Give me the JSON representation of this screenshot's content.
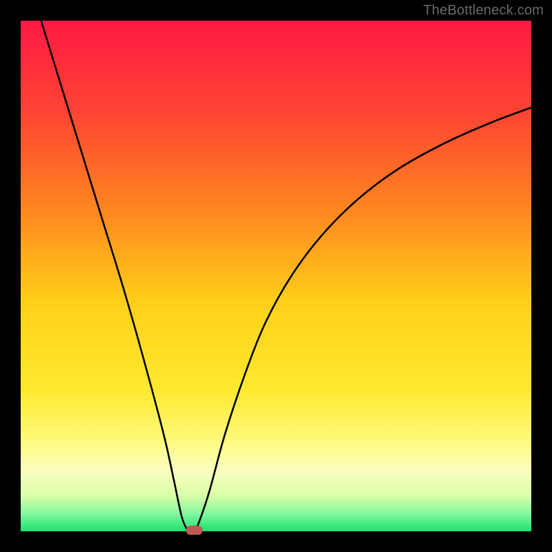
{
  "watermark": "TheBottleneck.com",
  "colors": {
    "frame": "#000000",
    "marker": "#bb5a53",
    "curve": "#000000",
    "watermark_text": "#6a6a6a"
  },
  "gradient_stops": [
    {
      "offset": 0.0,
      "color": "#ff1a44"
    },
    {
      "offset": 0.18,
      "color": "#ff4433"
    },
    {
      "offset": 0.38,
      "color": "#ff8a1f"
    },
    {
      "offset": 0.55,
      "color": "#ffcf1a"
    },
    {
      "offset": 0.72,
      "color": "#ffe92e"
    },
    {
      "offset": 0.82,
      "color": "#fff97a"
    },
    {
      "offset": 0.88,
      "color": "#faffc0"
    },
    {
      "offset": 0.93,
      "color": "#d9ffa8"
    },
    {
      "offset": 0.965,
      "color": "#86f7a0"
    },
    {
      "offset": 1.0,
      "color": "#17e36f"
    }
  ],
  "chart_data": {
    "type": "line",
    "title": "",
    "xlabel": "",
    "ylabel": "",
    "xlim": [
      0,
      100
    ],
    "ylim": [
      0,
      100
    ],
    "x_optimum": 33,
    "marker": {
      "x": 34,
      "y": 0
    },
    "series": [
      {
        "name": "bottleneck-curve",
        "points": [
          {
            "x": 4,
            "y": 100
          },
          {
            "x": 8,
            "y": 87
          },
          {
            "x": 12,
            "y": 74
          },
          {
            "x": 16,
            "y": 61
          },
          {
            "x": 20,
            "y": 48
          },
          {
            "x": 24,
            "y": 34
          },
          {
            "x": 28,
            "y": 19
          },
          {
            "x": 30,
            "y": 10
          },
          {
            "x": 31.5,
            "y": 3
          },
          {
            "x": 32.5,
            "y": 0.5
          },
          {
            "x": 33.0,
            "y": 0
          },
          {
            "x": 34.0,
            "y": 0
          },
          {
            "x": 35.0,
            "y": 2
          },
          {
            "x": 37.0,
            "y": 8
          },
          {
            "x": 40,
            "y": 19
          },
          {
            "x": 44,
            "y": 31
          },
          {
            "x": 48,
            "y": 41
          },
          {
            "x": 53,
            "y": 50
          },
          {
            "x": 59,
            "y": 58
          },
          {
            "x": 66,
            "y": 65
          },
          {
            "x": 74,
            "y": 71
          },
          {
            "x": 83,
            "y": 76
          },
          {
            "x": 92,
            "y": 80
          },
          {
            "x": 100,
            "y": 83
          }
        ]
      }
    ]
  }
}
